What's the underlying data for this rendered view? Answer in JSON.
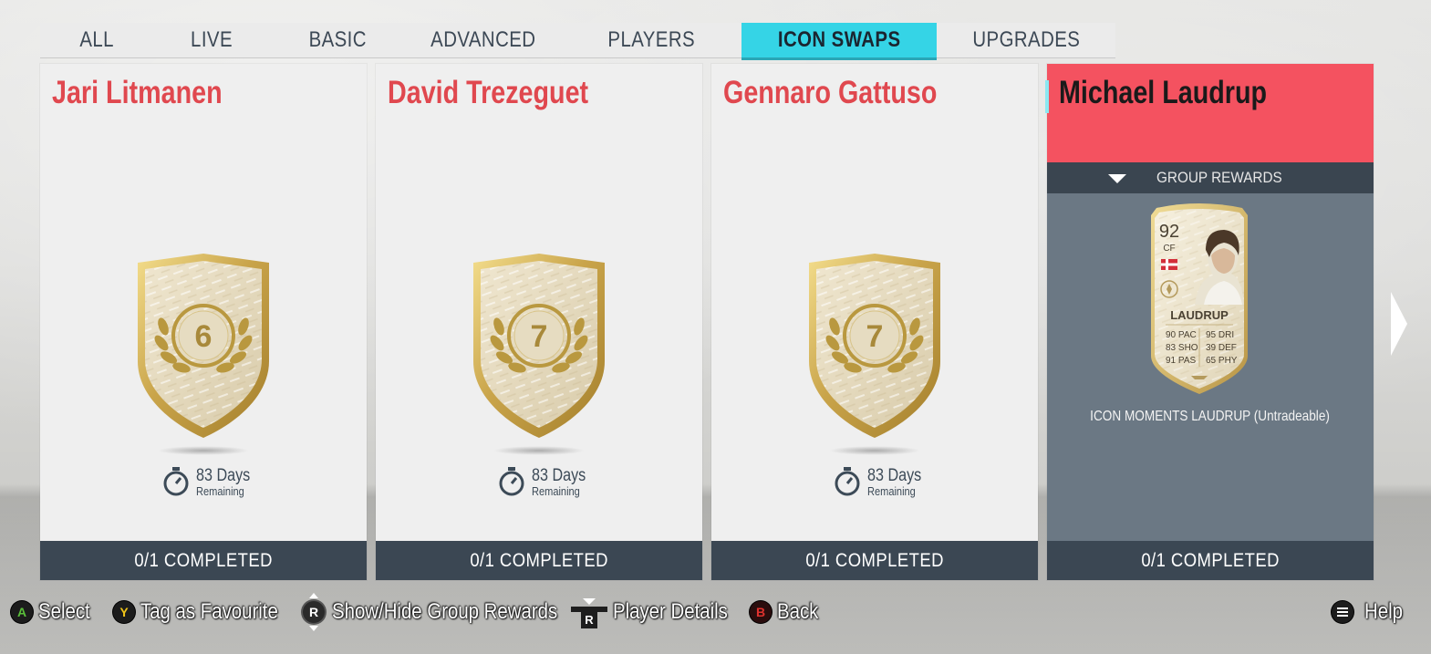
{
  "tabs": [
    {
      "label": "ALL",
      "active": false
    },
    {
      "label": "LIVE",
      "active": false
    },
    {
      "label": "BASIC",
      "active": false
    },
    {
      "label": "ADVANCED",
      "active": false
    },
    {
      "label": "PLAYERS",
      "active": false
    },
    {
      "label": "ICON SWAPS",
      "active": true
    },
    {
      "label": "UPGRADES",
      "active": false
    }
  ],
  "cards": [
    {
      "title": "Jari Litmanen",
      "badge_number": "6",
      "timer_days": "83 Days",
      "timer_remaining": "Remaining",
      "footer": "0/1 COMPLETED"
    },
    {
      "title": "David Trezeguet",
      "badge_number": "7",
      "timer_days": "83 Days",
      "timer_remaining": "Remaining",
      "footer": "0/1 COMPLETED"
    },
    {
      "title": "Gennaro Gattuso",
      "badge_number": "7",
      "timer_days": "83 Days",
      "timer_remaining": "Remaining",
      "footer": "0/1 COMPLETED"
    }
  ],
  "selected_card": {
    "title": "Michael Laudrup",
    "group_rewards_label": "GROUP REWARDS",
    "player_card": {
      "rating": "92",
      "position": "CF",
      "name": "LAUDRUP",
      "stats_left": [
        "90 PAC",
        "83 SHO",
        "91 PAS"
      ],
      "stats_right": [
        "95 DRI",
        "39 DEF",
        "65 PHY"
      ]
    },
    "reward_name": "ICON MOMENTS LAUDRUP (Untradeable)",
    "footer": "0/1 COMPLETED"
  },
  "help_bar": {
    "select": {
      "button": "A",
      "label": "Select",
      "color": "#5bbf3a"
    },
    "favourite": {
      "button": "Y",
      "label": "Tag as Favourite",
      "color": "#f0c419"
    },
    "group_rewards": {
      "button": "R",
      "label": "Show/Hide Group Rewards"
    },
    "player_details": {
      "button": "R",
      "label": "Player Details"
    },
    "back": {
      "button": "B",
      "label": "Back",
      "color": "#e0322e"
    },
    "help": {
      "label": "Help"
    }
  },
  "colors": {
    "active_tab": "#35d4e6",
    "title_red": "#e0484f",
    "selected_header": "#f45260",
    "footer_dark": "#3b4753",
    "selected_body": "#6b7884"
  }
}
